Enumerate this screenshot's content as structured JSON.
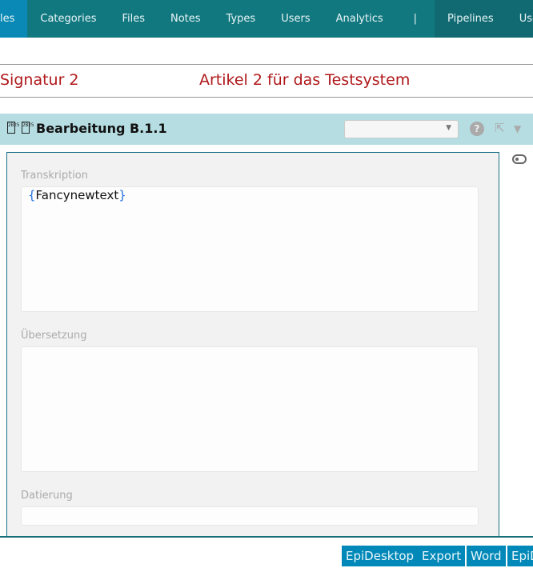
{
  "nav": {
    "items": [
      "les",
      "Categories",
      "Files",
      "Notes",
      "Types",
      "Users",
      "Analytics",
      "|"
    ],
    "right_items": [
      "Pipelines",
      "User"
    ]
  },
  "record": {
    "signature": "Signatur 2",
    "title": "Artikel 2 für das Testsystem"
  },
  "section": {
    "glyph": "2B25",
    "title": "Bearbeitung B.1.1",
    "select_value": "",
    "help": "?"
  },
  "fields": [
    {
      "label": "Transkription",
      "open": "{",
      "value": "Fancynewtext",
      "close": "}"
    },
    {
      "label": "Übersetzung",
      "value": ""
    },
    {
      "label": "Datierung",
      "value": ""
    }
  ],
  "footer": {
    "buttons": [
      "EpiDesktop",
      "Export",
      "Word",
      "EpiD"
    ]
  }
}
